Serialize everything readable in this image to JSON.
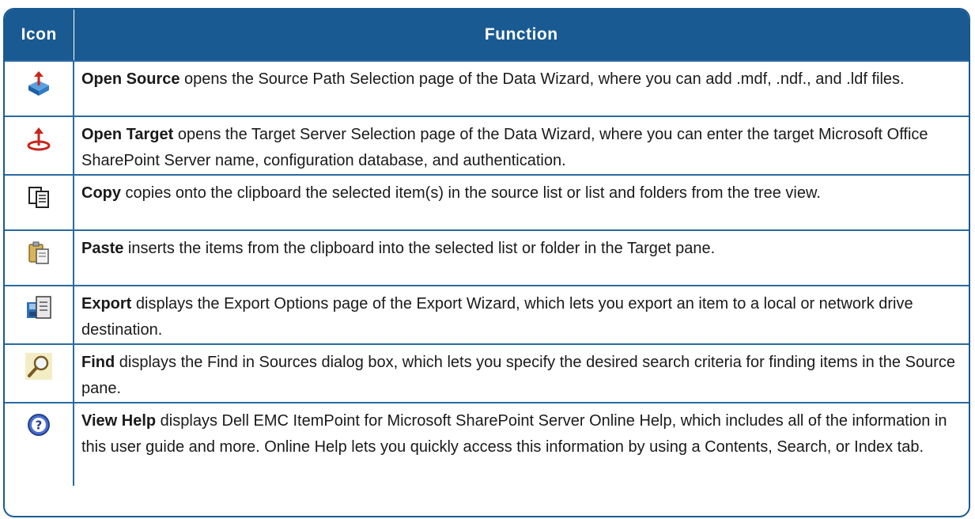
{
  "table": {
    "headers": {
      "icon": "Icon",
      "function": "Function"
    },
    "rows": [
      {
        "icon": "open-source-icon",
        "term": "Open Source",
        "text": " opens the Source Path Selection page of the Data Wizard, where you can add .mdf, .ndf., and .ldf files."
      },
      {
        "icon": "open-target-icon",
        "term": "Open Target",
        "text": " opens the Target Server Selection page of the Data Wizard, where you can enter the target Microsoft Office SharePoint Server name, configuration database, and authentication."
      },
      {
        "icon": "copy-icon",
        "term": "Copy",
        "text": " copies onto the clipboard the selected item(s) in the source list or list and folders from the tree view."
      },
      {
        "icon": "paste-icon",
        "term": "Paste",
        "text": " inserts the items from the clipboard into the selected list or folder in the Target pane."
      },
      {
        "icon": "export-icon",
        "term": "Export",
        "text": " displays the Export Options page of the Export Wizard, which lets you export an item to a local or network drive destination."
      },
      {
        "icon": "find-icon",
        "term": "Find",
        "text": " displays the Find in Sources dialog box, which lets you specify the desired search criteria for finding items in the Source pane."
      },
      {
        "icon": "help-icon",
        "term": "View Help",
        "text": " displays Dell EMC ItemPoint for Microsoft SharePoint Server Online Help, which includes all of the information in this user guide and more. Online Help lets you quickly access this information by using a Contents, Search, or Index tab."
      }
    ]
  },
  "colors": {
    "header": "#1a5a92",
    "border": "#2a6aa0"
  }
}
